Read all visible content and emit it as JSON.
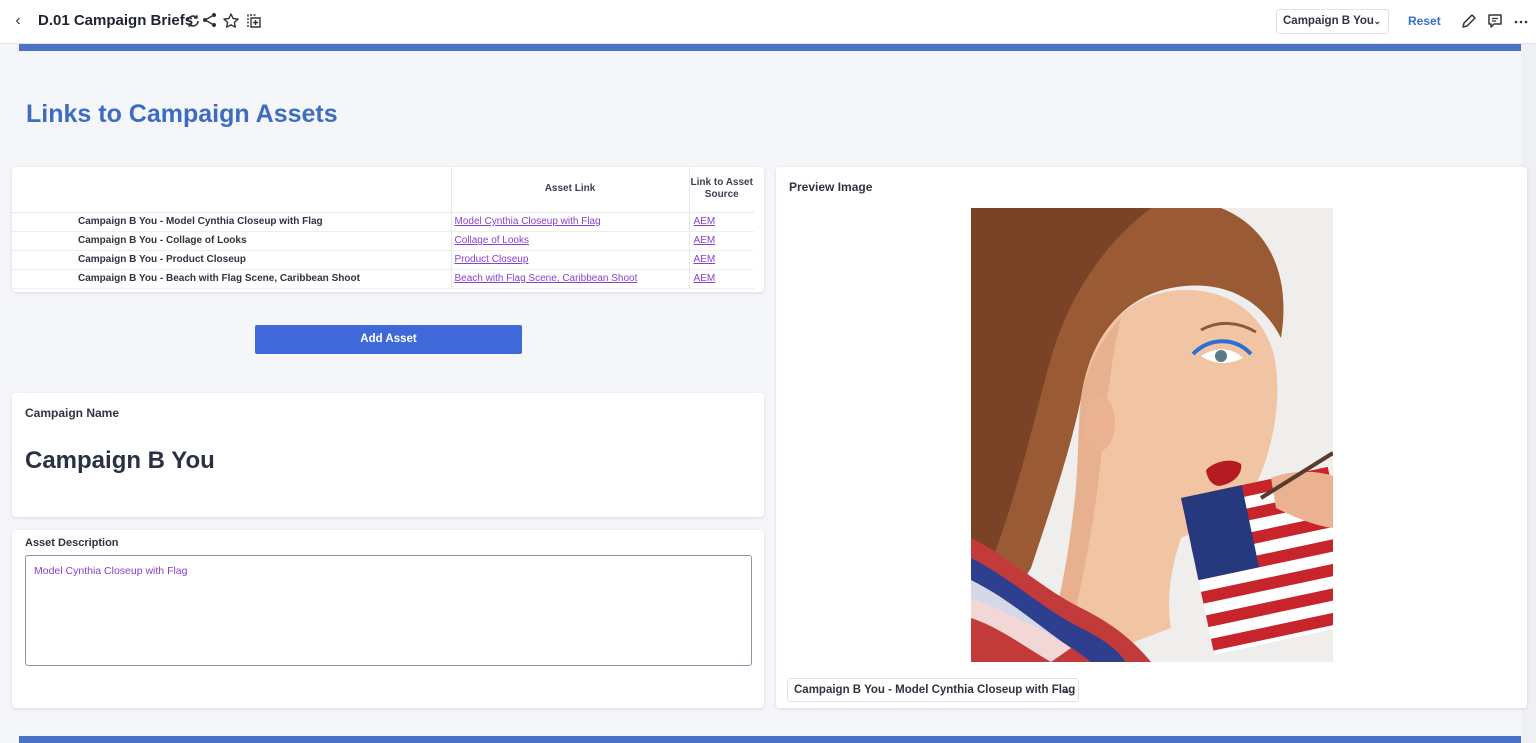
{
  "header": {
    "back_icon": "chevron-left-icon",
    "title": "D.01 Campaign Briefs",
    "icons": [
      "refresh-icon",
      "share-icon",
      "star-icon",
      "add-to-collection-icon"
    ],
    "campaign_select": "Campaign B You",
    "reset_label": "Reset",
    "right_icons": [
      "pencil-icon",
      "comment-icon",
      "more-icon"
    ],
    "accent_color": "#4a72c7"
  },
  "page": {
    "heading": "Links to Campaign Assets",
    "heading_color": "#3d6cc0"
  },
  "assets_table": {
    "columns": [
      "",
      "Asset Link",
      "Link to Asset Source"
    ],
    "rows": [
      {
        "name": "Campaign B You - Model Cynthia Closeup with Flag",
        "link": "Model Cynthia Closeup with Flag",
        "source": "AEM"
      },
      {
        "name": "Campaign B You - Collage of Looks",
        "link": "Collage of Looks",
        "source": "AEM"
      },
      {
        "name": "Campaign B You - Product Closeup",
        "link": "Product Closeup",
        "source": "AEM"
      },
      {
        "name": "Campaign B You - Beach with Flag Scene, Caribbean Shoot",
        "link": "Beach with Flag Scene, Caribbean Shoot",
        "source": "AEM"
      }
    ],
    "link_color": "#8a3fd1"
  },
  "add_asset_button": {
    "label": "Add Asset",
    "color": "#3f68d8"
  },
  "campaign_name_card": {
    "label": "Campaign Name",
    "value": "Campaign B You"
  },
  "asset_description_card": {
    "label": "Asset Description",
    "value": "Model Cynthia Closeup with Flag"
  },
  "preview_card": {
    "label": "Preview Image",
    "image": "model-with-american-flag-photo",
    "select_value": "Campaign B You - Model Cynthia Closeup with Flag"
  }
}
